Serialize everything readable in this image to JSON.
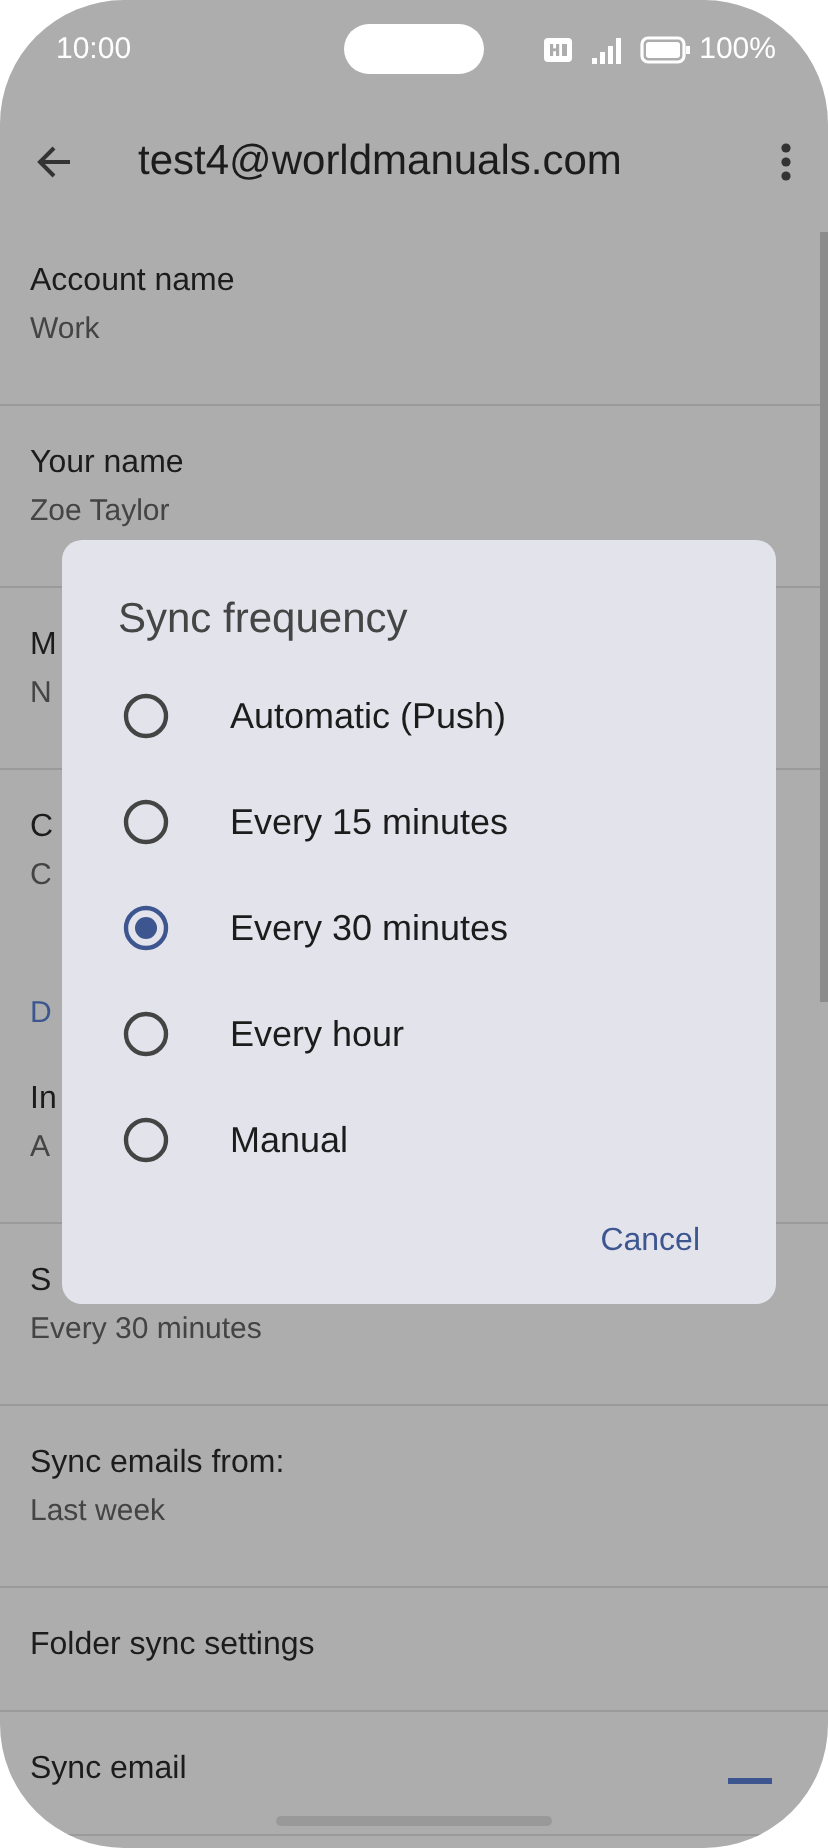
{
  "status_bar": {
    "time": "10:00",
    "battery": "100%"
  },
  "app_bar": {
    "title": "test4@worldmanuals.com"
  },
  "settings": [
    {
      "kind": "item",
      "title": "Account name",
      "value": "Work"
    },
    {
      "kind": "item",
      "title": "Your name",
      "value": "Zoe Taylor"
    },
    {
      "kind": "item",
      "title": "M",
      "value": "N"
    },
    {
      "kind": "item",
      "title": "C",
      "value": "C"
    },
    {
      "kind": "header",
      "title": "D"
    },
    {
      "kind": "item",
      "title": "In",
      "value": "A"
    },
    {
      "kind": "item",
      "title": "S",
      "value": "Every 30 minutes"
    },
    {
      "kind": "item",
      "title": "Sync emails from:",
      "value": "Last week"
    },
    {
      "kind": "item",
      "title": "Folder sync settings"
    },
    {
      "kind": "toggle",
      "title": "Sync email",
      "on": true
    }
  ],
  "dialog": {
    "title": "Sync frequency",
    "options": [
      {
        "label": "Automatic (Push)",
        "selected": false
      },
      {
        "label": "Every 15 minutes",
        "selected": false
      },
      {
        "label": "Every 30 minutes",
        "selected": true
      },
      {
        "label": "Every hour",
        "selected": false
      },
      {
        "label": "Manual",
        "selected": false
      }
    ],
    "buttons": [
      "Cancel"
    ]
  }
}
